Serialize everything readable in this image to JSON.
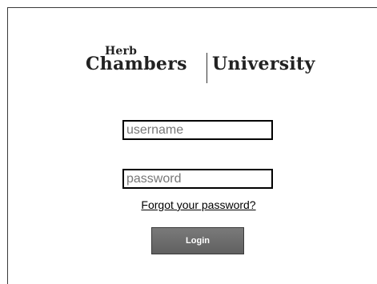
{
  "logo": {
    "herb": "Herb",
    "chambers": "Chambers",
    "university": "University"
  },
  "form": {
    "username_placeholder": "username",
    "username_value": "",
    "password_placeholder": "password",
    "password_value": "",
    "forgot_label": "Forgot your password?",
    "login_label": "Login"
  }
}
